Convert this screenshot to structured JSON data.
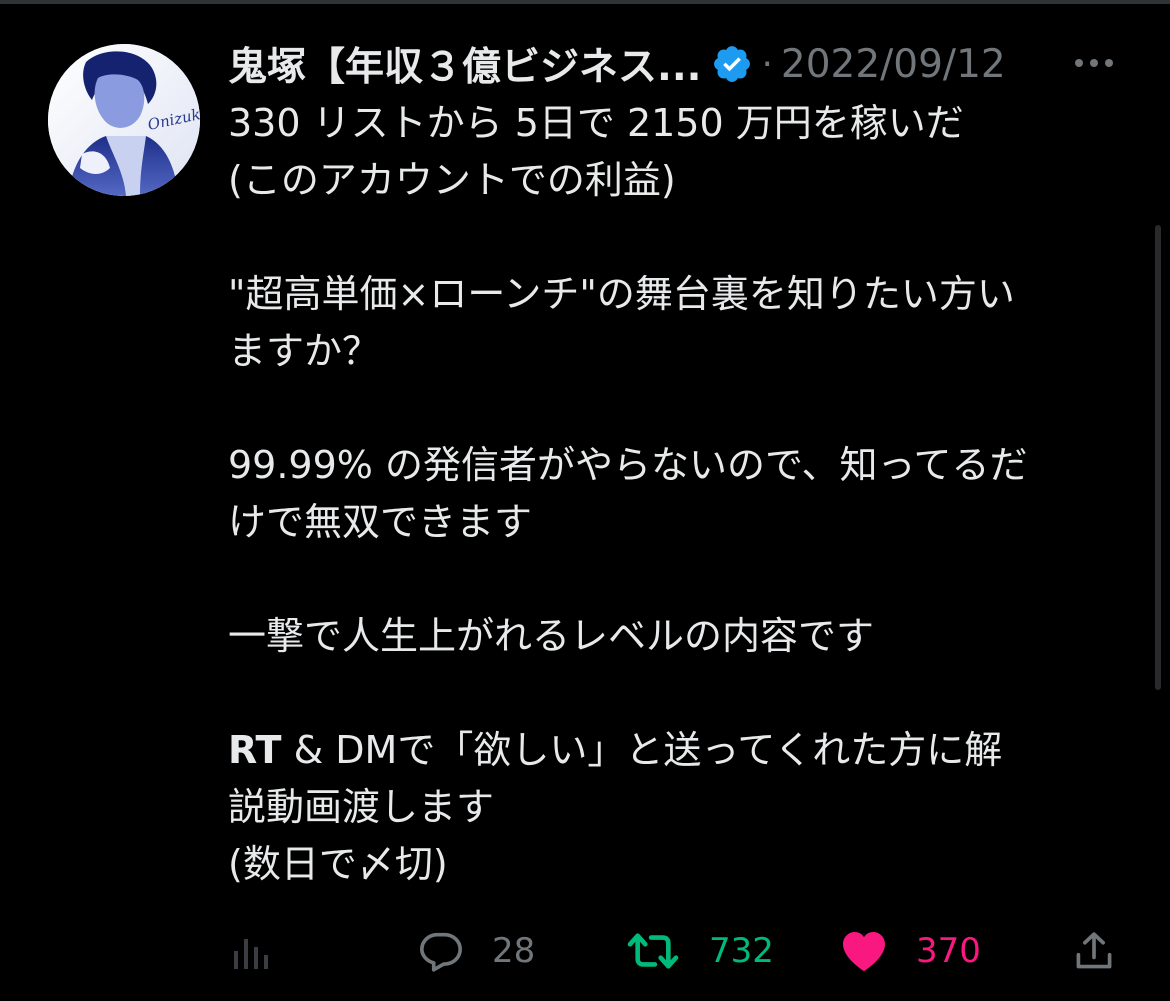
{
  "tweet": {
    "author": {
      "display_name": "鬼塚【年収３億ビジネス...",
      "verified": true,
      "avatar_signature": "Onizuka"
    },
    "separator": "·",
    "date": "2022/09/12",
    "more_icon": "ellipsis-icon",
    "body_lines": [
      "330 リストから 5日で 2150 万円を稼いだ",
      "(このアカウントでの利益)",
      "",
      "\"超高単価×ローンチ\"の舞台裏を知りたい方い",
      "ますか？",
      "",
      "99.99% の発信者がやらないので、知ってるだ",
      "けで無双できます",
      "",
      "一撃で人生上がれるレベルの内容です",
      "",
      "& DMで「欲しい」と送ってくれた方に解",
      "説動画渡します",
      "(数日で〆切)"
    ],
    "rt_prefix": "RT",
    "stats": {
      "views_icon": "bar-chart-icon",
      "replies": "28",
      "retweets": "732",
      "likes": "370",
      "share_icon": "share-icon"
    }
  },
  "colors": {
    "background": "#000000",
    "text_primary": "#e7e9ea",
    "text_secondary": "#71767b",
    "verified_blue": "#1d9bf0",
    "retweet_green": "#00ba7c",
    "like_pink": "#f91880"
  }
}
